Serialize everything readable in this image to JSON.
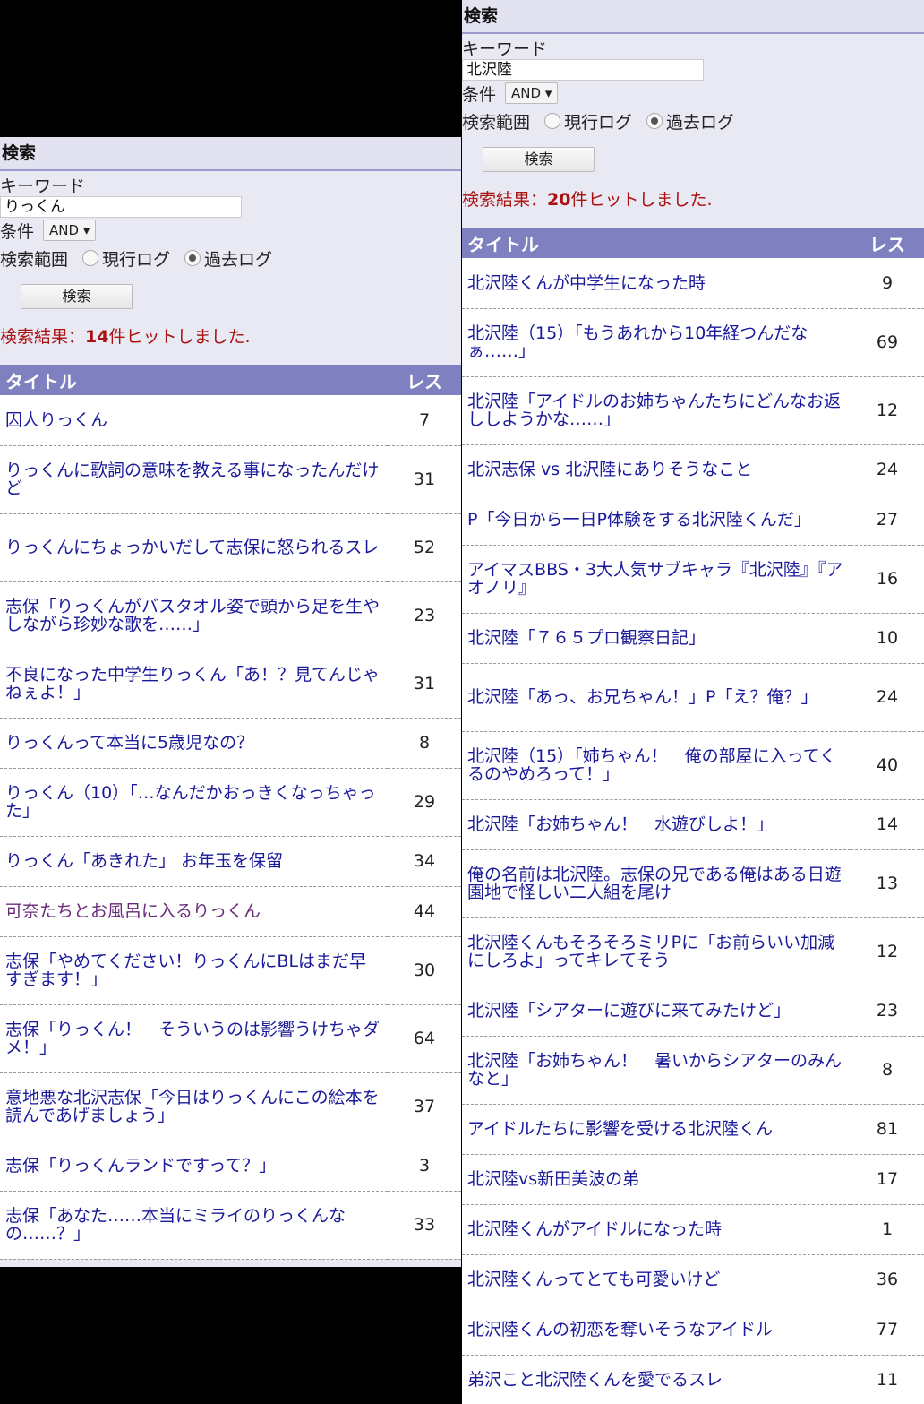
{
  "left": {
    "heading": "検索",
    "keyword_label": "キーワード",
    "keyword_value": "りっくん",
    "condition_label": "条件",
    "condition_value": "AND ▾",
    "range_label": "検索範囲",
    "range_current": "現行ログ",
    "range_past": "過去ログ",
    "submit": "検索",
    "result_prefix": "検索結果：",
    "result_count": "14",
    "result_suffix": "件ヒットしました.",
    "col_title": "タイトル",
    "col_res": "レス",
    "rows": [
      {
        "title": "囚人りっくん",
        "res": "7"
      },
      {
        "title": "りっくんに歌詞の意味を教える事になったんだけど",
        "res": "31"
      },
      {
        "title": "りっくんにちょっかいだして志保に怒られるスレ",
        "res": "52"
      },
      {
        "title": "志保「りっくんがバスタオル姿で頭から足を生やしながら珍妙な歌を……」",
        "res": "23"
      },
      {
        "title": "不良になった中学生りっくん「あ！？見てんじゃねぇよ！」",
        "res": "31"
      },
      {
        "title": "りっくんって本当に5歳児なの？",
        "res": "8"
      },
      {
        "title": "りっくん（10）「…なんだかおっきくなっちゃった」",
        "res": "29"
      },
      {
        "title": "りっくん「あきれた」 お年玉を保留",
        "res": "34"
      },
      {
        "title": "可奈たちとお風呂に入るりっくん",
        "res": "44"
      },
      {
        "title": "志保「やめてください！りっくんにBLはまだ早すぎます！」",
        "res": "30"
      },
      {
        "title": "志保「りっくん！　そういうのは影響うけちゃダメ！」",
        "res": "64"
      },
      {
        "title": "意地悪な北沢志保「今日はりっくんにこの絵本を読んであげましょう」",
        "res": "37"
      },
      {
        "title": "志保「りっくんランドですって？」",
        "res": "3"
      },
      {
        "title": "志保「あなた……本当にミライのりっくんなの……？」",
        "res": "33"
      }
    ]
  },
  "right": {
    "heading": "検索",
    "keyword_label": "キーワード",
    "keyword_value": "北沢陸",
    "condition_label": "条件",
    "condition_value": "AND ▾",
    "range_label": "検索範囲",
    "range_current": "現行ログ",
    "range_past": "過去ログ",
    "submit": "検索",
    "result_prefix": "検索結果：",
    "result_count": "20",
    "result_suffix": "件ヒットしました.",
    "col_title": "タイトル",
    "col_res": "レス",
    "rows": [
      {
        "title": "北沢陸くんが中学生になった時",
        "res": "9"
      },
      {
        "title": "北沢陸（15）「もうあれから10年経つんだなぁ……」",
        "res": "69"
      },
      {
        "title": "北沢陸「アイドルのお姉ちゃんたちにどんなお返ししようかな……」",
        "res": "12"
      },
      {
        "title": "北沢志保 vs 北沢陸にありそうなこと",
        "res": "24"
      },
      {
        "title": "P「今日から一日P体験をする北沢陸くんだ」",
        "res": "27"
      },
      {
        "title": "アイマスBBS・3大人気サブキャラ『北沢陸』『アオノリ』",
        "res": "16"
      },
      {
        "title": "北沢陸「７６５プロ観察日記」",
        "res": "10"
      },
      {
        "title": "北沢陸「あっ、お兄ちゃん！」P「え？俺？」",
        "res": "24"
      },
      {
        "title": "北沢陸（15）「姉ちゃん！　俺の部屋に入ってくるのやめろって！」",
        "res": "40"
      },
      {
        "title": "北沢陸「お姉ちゃん！　水遊びしよ！」",
        "res": "14"
      },
      {
        "title": "俺の名前は北沢陸。志保の兄である俺はある日遊園地で怪しい二人組を尾け",
        "res": "13"
      },
      {
        "title": "北沢陸くんもそろそろミリPに「お前らいい加減にしろよ」ってキレてそう",
        "res": "12"
      },
      {
        "title": "北沢陸「シアターに遊びに来てみたけど」",
        "res": "23"
      },
      {
        "title": "北沢陸「お姉ちゃん！　暑いからシアターのみんなと」",
        "res": "8"
      },
      {
        "title": "アイドルたちに影響を受ける北沢陸くん",
        "res": "81"
      },
      {
        "title": "北沢陸vs新田美波の弟",
        "res": "17"
      },
      {
        "title": "北沢陸くんがアイドルになった時",
        "res": "1"
      },
      {
        "title": "北沢陸くんってとても可愛いけど",
        "res": "36"
      },
      {
        "title": "北沢陸くんの初恋を奪いそうなアイドル",
        "res": "77"
      },
      {
        "title": "弟沢こと北沢陸くんを愛でるスレ",
        "res": "11"
      }
    ]
  }
}
